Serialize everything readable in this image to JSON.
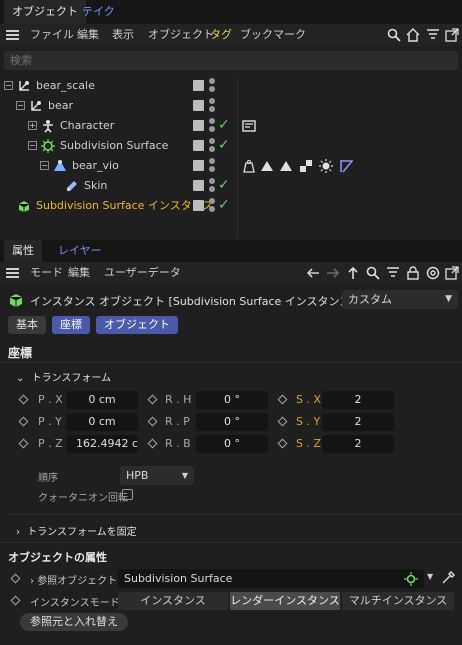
{
  "top_tabs": [
    {
      "label": "オブジェクト",
      "active": true
    },
    {
      "label": "テイク",
      "active": false
    }
  ],
  "menu": [
    "ファイル",
    "編集",
    "表示",
    "オブジェクト",
    "タグ",
    "ブックマーク"
  ],
  "search": {
    "placeholder": "検索"
  },
  "tree": [
    {
      "label": "bear_scale",
      "indent": 0,
      "expander": "−",
      "check": false,
      "color": "#cfcfcf"
    },
    {
      "label": "bear",
      "indent": 1,
      "expander": "−",
      "check": false,
      "color": "#cfcfcf"
    },
    {
      "label": "Character",
      "indent": 2,
      "expander": "+",
      "check": true,
      "color": "#cfcfcf"
    },
    {
      "label": "Subdivision Surface",
      "indent": 2,
      "expander": "−",
      "check": true,
      "color": "#cfcfcf"
    },
    {
      "label": "bear_vio",
      "indent": 3,
      "expander": "−",
      "check": false,
      "color": "#cfcfcf"
    },
    {
      "label": "Skin",
      "indent": 4,
      "expander": "",
      "check": true,
      "color": "#cfcfcf"
    },
    {
      "label": "Subdivision Surface インスタンス",
      "indent": 0,
      "expander": "",
      "check": true,
      "color": "#f0b830"
    }
  ],
  "attr_tabs": [
    {
      "label": "属性",
      "active": true
    },
    {
      "label": "レイヤー",
      "active": false
    }
  ],
  "attr_menu": [
    "モード",
    "編集",
    "ユーザーデータ"
  ],
  "object_title": "インスタンス オブジェクト [Subdivision Surface インスタンス]",
  "preset": "カスタム",
  "pill_tabs": [
    {
      "label": "基本",
      "active": false
    },
    {
      "label": "座標",
      "active": true
    },
    {
      "label": "オブジェクト",
      "active": true
    }
  ],
  "coords": {
    "section": "座標",
    "transform_label": "トランスフォーム",
    "rows": [
      {
        "p_label": "P . X",
        "p_val": "0 cm",
        "r_label": "R . H",
        "r_val": "0 °",
        "s_label": "S . X",
        "s_val": "2"
      },
      {
        "p_label": "P . Y",
        "p_val": "0 cm",
        "r_label": "R . P",
        "r_val": "0 °",
        "s_label": "S . Y",
        "s_val": "2"
      },
      {
        "p_label": "P . Z",
        "p_val": "162.4942 c",
        "r_label": "R . B",
        "r_val": "0 °",
        "s_label": "S . Z",
        "s_val": "2"
      }
    ],
    "order_label": "順序",
    "order_value": "HPB",
    "quat_label": "クォータニオン回転",
    "freeze_label": "トランスフォームを固定"
  },
  "object_props": {
    "section": "オブジェクトの属性",
    "ref_label": "参照オブジェクト",
    "ref_value": "Subdivision Surface",
    "mode_label": "インスタンスモード",
    "modes": [
      {
        "label": "インスタンス",
        "selected": false
      },
      {
        "label": "レンダーインスタンス",
        "selected": true
      },
      {
        "label": "マルチインスタンス",
        "selected": false
      }
    ],
    "swap_button": "参照元と入れ替え"
  },
  "colors": {
    "accent_blue": "#7f8cff",
    "check_green": "#5fd35f",
    "orange": "#e0a030",
    "pill_blue": "#4a5aa8"
  }
}
